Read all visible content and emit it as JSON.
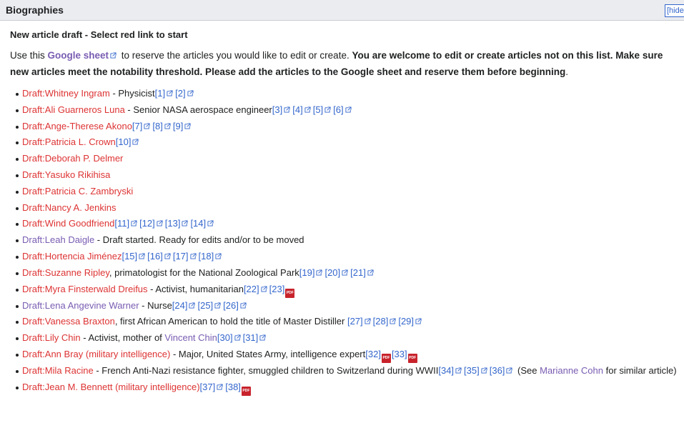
{
  "header": {
    "title": "Biographies",
    "hide_label": "[hide"
  },
  "subtitle": "New article draft - Select red link to start",
  "intro": {
    "text1": "Use this ",
    "sheet_link": "Google sheet",
    "text2": " to reserve the articles you would like to edit or create. ",
    "bold": "You are welcome to edit or create articles not on this list. Make sure new articles meet the notability threshold. Please add the articles to the Google sheet and reserve them before beginning",
    "end": "."
  },
  "items": [
    {
      "name": "Draft:Whitney Ingram",
      "desc": " - Physicist",
      "refs": [
        "[1]",
        "[2]"
      ]
    },
    {
      "name": "Draft:Ali Guarneros Luna",
      "desc": " - Senior NASA aerospace engineer",
      "refs": [
        "[3]",
        "[4]",
        "[5]",
        "[6]"
      ]
    },
    {
      "name": "Draft:Ange-Therese Akono",
      "refs": [
        "[7]",
        "[8]",
        "[9]"
      ]
    },
    {
      "name": "Draft:Patricia L. Crown",
      "refs": [
        "[10]"
      ]
    },
    {
      "name": "Draft:Deborah P. Delmer"
    },
    {
      "name": "Draft:Yasuko Rikihisa"
    },
    {
      "name": "Draft:Patricia C. Zambryski"
    },
    {
      "name": "Draft:Nancy A. Jenkins"
    },
    {
      "name": "Draft:Wind Goodfriend",
      "refs": [
        "[11]",
        "[12]",
        "[13]",
        "[14]"
      ]
    },
    {
      "name": "Draft:Leah Daigle",
      "desc": " - Draft started. Ready for edits and/or to be moved"
    },
    {
      "name": "Draft:Hortencia Jiménez",
      "refs": [
        "[15]",
        "[16]",
        "[17]",
        "[18]"
      ]
    },
    {
      "name": "Draft:Suzanne Ripley",
      "desc": ", primatologist for the National Zoological Park",
      "refs": [
        "[19]",
        "[20]",
        "[21]"
      ]
    },
    {
      "name": "Draft:Myra Finsterwald Dreifus",
      "desc": " - Activist, humanitarian",
      "refs": [
        "[22]",
        "[23]"
      ],
      "ref_icons": [
        "ext",
        "pdf"
      ]
    },
    {
      "name": "Draft:Lena Angevine Warner",
      "desc": " - Nurse",
      "refs": [
        "[24]",
        "[25]",
        "[26]"
      ]
    },
    {
      "name": "Draft:Vanessa Braxton",
      "desc": ", first African American to hold the title of Master Distiller ",
      "refs": [
        "[27]",
        "[28]",
        "[29]"
      ]
    },
    {
      "name": "Draft:Lily Chin",
      "desc": " - Activist, mother of ",
      "link2": "Vincent Chin",
      "refs": [
        "[30]",
        "[31]"
      ]
    },
    {
      "name": "Draft:Ann Bray (military intelligence)",
      "desc": " - Major, United States Army, intelligence expert",
      "refs": [
        "[32]",
        "[33]"
      ],
      "ref_icons": [
        "pdf",
        "pdf"
      ]
    },
    {
      "name": "Draft:Mila Racine",
      "desc": " - French Anti-Nazi resistance fighter, smuggled children to Switzerland during WWII",
      "refs": [
        "[34]",
        "[35]",
        "[36]"
      ],
      "after": " (See ",
      "link3": "Marianne Cohn",
      "after2": " for similar article)"
    },
    {
      "name": "Draft:Jean M. Bennett (military intelligence)",
      "refs": [
        "[37]",
        "[38]"
      ],
      "ref_icons": [
        "ext",
        "pdf"
      ]
    }
  ],
  "pdf_label": "PDF",
  "icons": {
    "external": "external-link-icon",
    "pdf": "pdf-icon"
  },
  "colors": {
    "redlink": "#d33333",
    "link": "#3366cc",
    "visited": "#795cb2",
    "header_bg": "#eaecf0"
  }
}
